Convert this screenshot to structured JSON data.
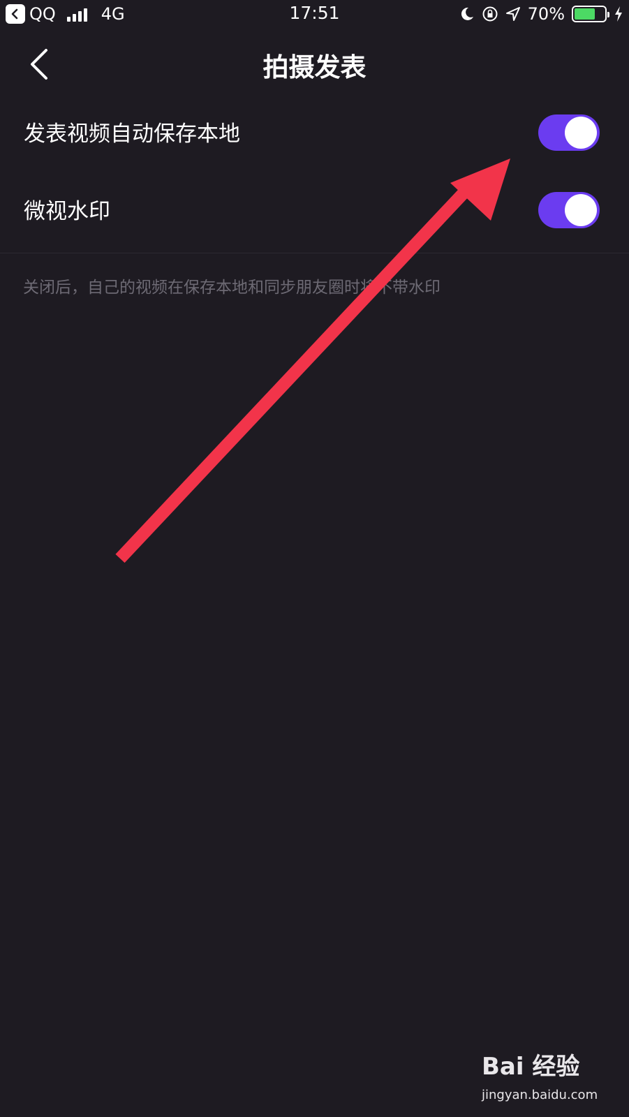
{
  "status_bar": {
    "app": "QQ",
    "network": "4G",
    "time": "17:51",
    "battery": "70%",
    "battery_level": 0.7,
    "icons": [
      "back-app-icon",
      "signal-icon",
      "moon-icon",
      "rotation-lock-icon",
      "location-icon",
      "battery-icon",
      "charging-icon"
    ]
  },
  "nav": {
    "title": "拍摄发表",
    "back_icon": "chevron-left-icon"
  },
  "settings": {
    "items": [
      {
        "label": "发表视频自动保存本地",
        "enabled": true
      },
      {
        "label": "微视水印",
        "enabled": true
      }
    ],
    "hint": "关闭后，自己的视频在保存本地和同步朋友圈时将不带水印"
  },
  "colors": {
    "background": "#1e1b22",
    "toggle_on": "#6b3cf0",
    "annotation_arrow": "#f2344a",
    "hint_text": "#6d6a74"
  },
  "watermark": {
    "logo": "Bai 经验",
    "url": "jingyan.baidu.com"
  }
}
